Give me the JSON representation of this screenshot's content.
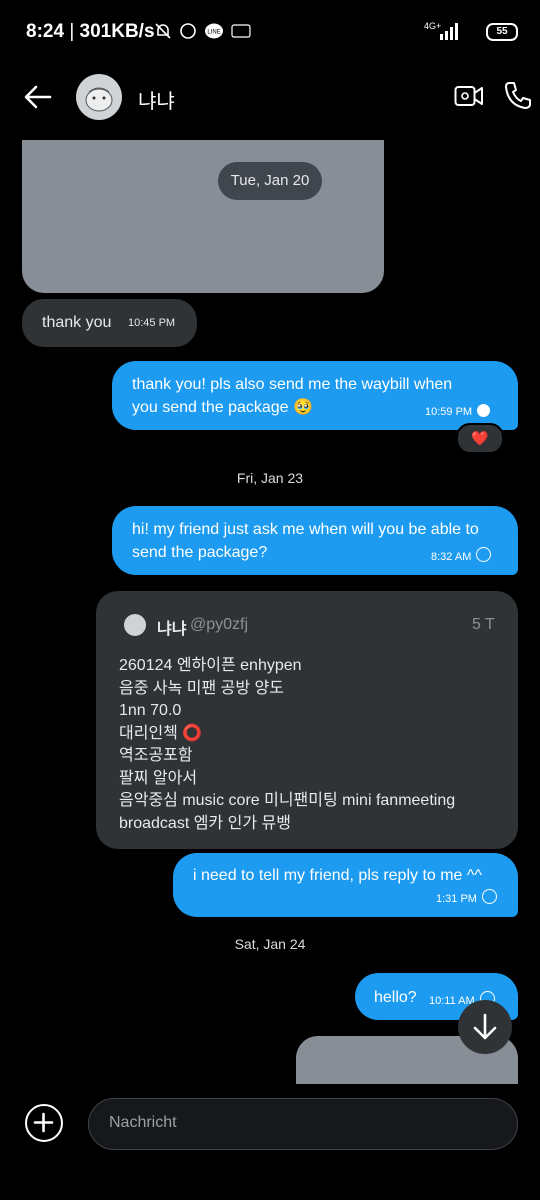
{
  "status_bar": {
    "time": "8:24",
    "speed": "301KB/s",
    "network": "4G+",
    "battery": "55"
  },
  "header": {
    "contact_name": "냐냐",
    "back_icon": "arrow-left-icon",
    "video_icon": "video-call-icon",
    "phone_icon": "phone-icon"
  },
  "messages": {
    "date1": "Tue, Jan 20",
    "in1": {
      "text": "thank you",
      "time": "10:45 PM"
    },
    "out1": {
      "line1": "thank you! pls also send me the waybill when",
      "line2": "you send the package 🥹",
      "time": "10:59 PM",
      "reaction": "❤️"
    },
    "date2": "Fri, Jan 23",
    "out2": {
      "line1": "hi! my friend just ask me when will you be able to",
      "line2": "send the package?",
      "time": "8:32 AM"
    },
    "quote": {
      "author": "냐냐",
      "handle": "@py0zfj",
      "age": "5 T",
      "text": "260124 엔하이픈 enhypen\n음중 사녹 미팬 공방 양도\n1nn 70.0\n대리인첵 ⭕\n역조공포함\n팔찌 알아서\n음악중심 music core 미니팬미팅 mini fanmeeting\nbroadcast 엠카 인가 뮤뱅"
    },
    "out3": {
      "text": "i need to tell my friend, pls reply to me ^^",
      "time": "1:31 PM"
    },
    "date3": "Sat, Jan 24",
    "out4": {
      "text": "hello?",
      "time": "10:11 AM"
    }
  },
  "composer": {
    "placeholder": "Nachricht"
  },
  "colors": {
    "accent": "#1d9bf0",
    "bubble_in": "#2f3336",
    "background": "#000000"
  }
}
